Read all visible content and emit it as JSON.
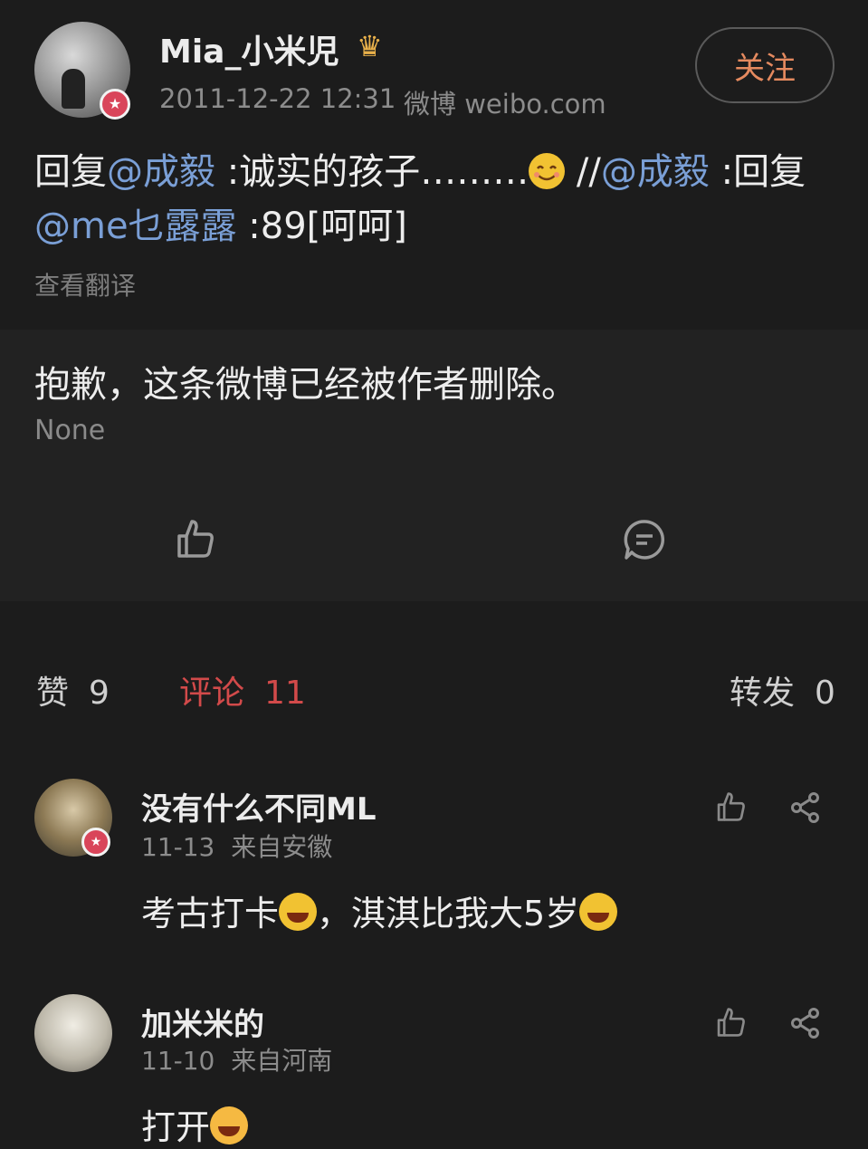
{
  "post": {
    "username": "Mia_小米児",
    "time": "2011-12-22 12:31",
    "source": "微博 weibo.com",
    "follow_label": "关注",
    "text_parts": [
      "回复",
      "@成毅",
      " :诚实的孩子………",
      " //",
      "@成毅",
      " :回复",
      "@me乜露露",
      " :89[呵呵]"
    ],
    "translate_label": "查看翻译"
  },
  "retweet": {
    "deleted_text": "抱歉，这条微博已经被作者删除。",
    "sub_text": "None"
  },
  "stats": {
    "like_label": "赞",
    "like_count": "9",
    "comment_label": "评论",
    "comment_count": "11",
    "repost_label": "转发",
    "repost_count": "0"
  },
  "comments": [
    {
      "name": "没有什么不同ML",
      "date": "11-13",
      "location": "来自安徽",
      "text_parts": [
        "考古打卡",
        "，淇淇比我大5岁"
      ]
    },
    {
      "name": "加米米的",
      "date": "11-10",
      "location": "来自河南",
      "text_parts": [
        "打开"
      ]
    }
  ],
  "colors": {
    "background": "#1c1c1c",
    "mention": "#7a9fd6",
    "follow": "#e58a5f",
    "active_tab": "#d24a4a"
  }
}
